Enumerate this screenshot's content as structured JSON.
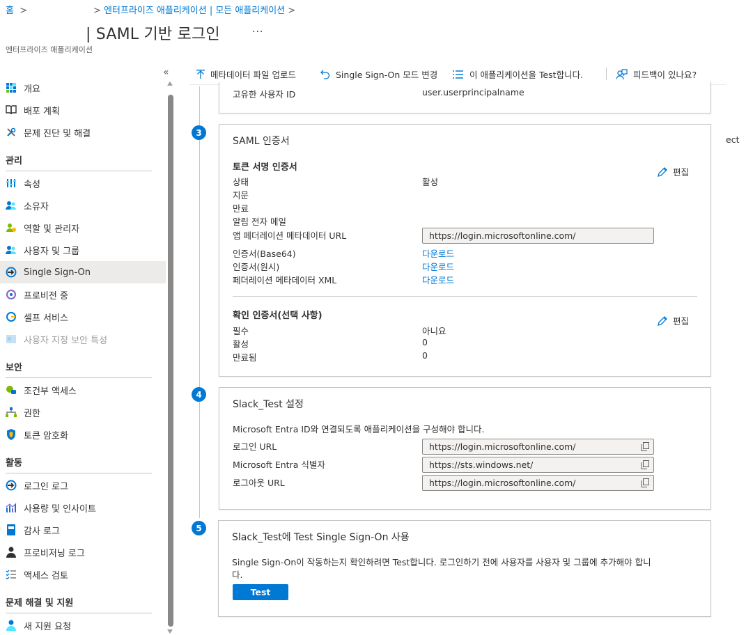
{
  "breadcrumb": {
    "home": "홈",
    "apps": "엔터프라이즈 애플리케이션 | 모든 애플리케이션"
  },
  "header": {
    "title": "| SAML 기반 로그인",
    "more": "···",
    "subtitle": "엔터프라이즈 애플리케이션"
  },
  "sidebar": {
    "collapse": "«",
    "items": [
      {
        "label": "개요",
        "icon": "overview-grid-icon"
      },
      {
        "label": "배포 계획",
        "icon": "book-icon"
      },
      {
        "label": "문제 진단 및 해결",
        "icon": "wrench-icon"
      }
    ],
    "manage_title": "관리",
    "manage_items": [
      {
        "label": "속성",
        "icon": "properties-bars-icon"
      },
      {
        "label": "소유자",
        "icon": "owners-icon"
      },
      {
        "label": "역할 및 관리자",
        "icon": "roles-icon"
      },
      {
        "label": "사용자 및 그룹",
        "icon": "users-groups-icon"
      },
      {
        "label": "Single Sign-On",
        "icon": "sso-icon"
      },
      {
        "label": "프로비전 중",
        "icon": "provisioning-icon"
      },
      {
        "label": "셀프 서비스",
        "icon": "self-service-icon"
      },
      {
        "label": "사용자 지정 보안 특성",
        "icon": "custom-security-icon"
      }
    ],
    "security_title": "보안",
    "security_items": [
      {
        "label": "조건부 액세스",
        "icon": "conditional-access-icon"
      },
      {
        "label": "권한",
        "icon": "permissions-icon"
      },
      {
        "label": "토큰 암호화",
        "icon": "shield-icon"
      }
    ],
    "activity_title": "활동",
    "activity_items": [
      {
        "label": "로그인 로그",
        "icon": "sign-in-logs-icon"
      },
      {
        "label": "사용량 및 인사이트",
        "icon": "usage-chart-icon"
      },
      {
        "label": "감사 로그",
        "icon": "audit-log-icon"
      },
      {
        "label": "프로비저닝 로그",
        "icon": "provisioning-log-icon"
      },
      {
        "label": "액세스 검토",
        "icon": "access-review-icon"
      }
    ],
    "support_title": "문제 해결 및 지원",
    "support_items": [
      {
        "label": "새 지원 요청",
        "icon": "support-person-icon"
      }
    ]
  },
  "toolbar": {
    "upload": "메타데이터 파일 업로드",
    "change_mode": "Single Sign-On 모드 변경",
    "test_app": "이 애플리케이션을 Test합니다.",
    "feedback": "피드백이 있나요?"
  },
  "edge_text": "ect",
  "step2": {
    "unique_id_label": "고유한 사용자 ID",
    "unique_id_value": "user.userprincipalname"
  },
  "step3": {
    "number": "3",
    "title": "SAML 인증서",
    "token_heading": "토큰 서명 인증서",
    "edit": "편집",
    "status_label": "상태",
    "status_value": "활성",
    "thumbprint_label": "지문",
    "expiration_label": "만료",
    "notify_email_label": "알림 전자 메일",
    "metadata_url_label": "앱 페더레이션 메타데이터 URL",
    "metadata_url_value": "https://login.microsoftonline.com/",
    "cert_base64_label": "인증서(Base64)",
    "cert_raw_label": "인증서(원시)",
    "fed_xml_label": "페더레이션 메타데이터 XML",
    "download": "다운로드",
    "verify_heading": "확인 인증서(선택 사항)",
    "verify_edit": "편집",
    "required_label": "필수",
    "required_value": "아니요",
    "active_label": "활성",
    "active_value": "0",
    "expired_label": "만료됨",
    "expired_value": "0"
  },
  "step4": {
    "number": "4",
    "title": "Slack_Test 설정",
    "description": "Microsoft Entra ID와 연결되도록 애플리케이션을 구성해야 합니다.",
    "login_url_label": "로그인 URL",
    "login_url_value": "https://login.microsoftonline.com/",
    "identifier_label": "Microsoft Entra 식별자",
    "identifier_value": "https://sts.windows.net/",
    "logout_url_label": "로그아웃 URL",
    "logout_url_value": "https://login.microsoftonline.com/"
  },
  "step5": {
    "number": "5",
    "title": "Slack_Test에 Test Single Sign-On 사용",
    "description_line1": "Single Sign-On이 작동하는지 확인하려면 Test합니다. 로그인하기 전에 사용자를 사용자 및 그룹에 추가해야 합니",
    "description_line2": "다.",
    "button": "Test"
  },
  "colors": {
    "accent": "#0078d4",
    "active_nav": "#edebe9",
    "border": "#c8c6c4"
  }
}
